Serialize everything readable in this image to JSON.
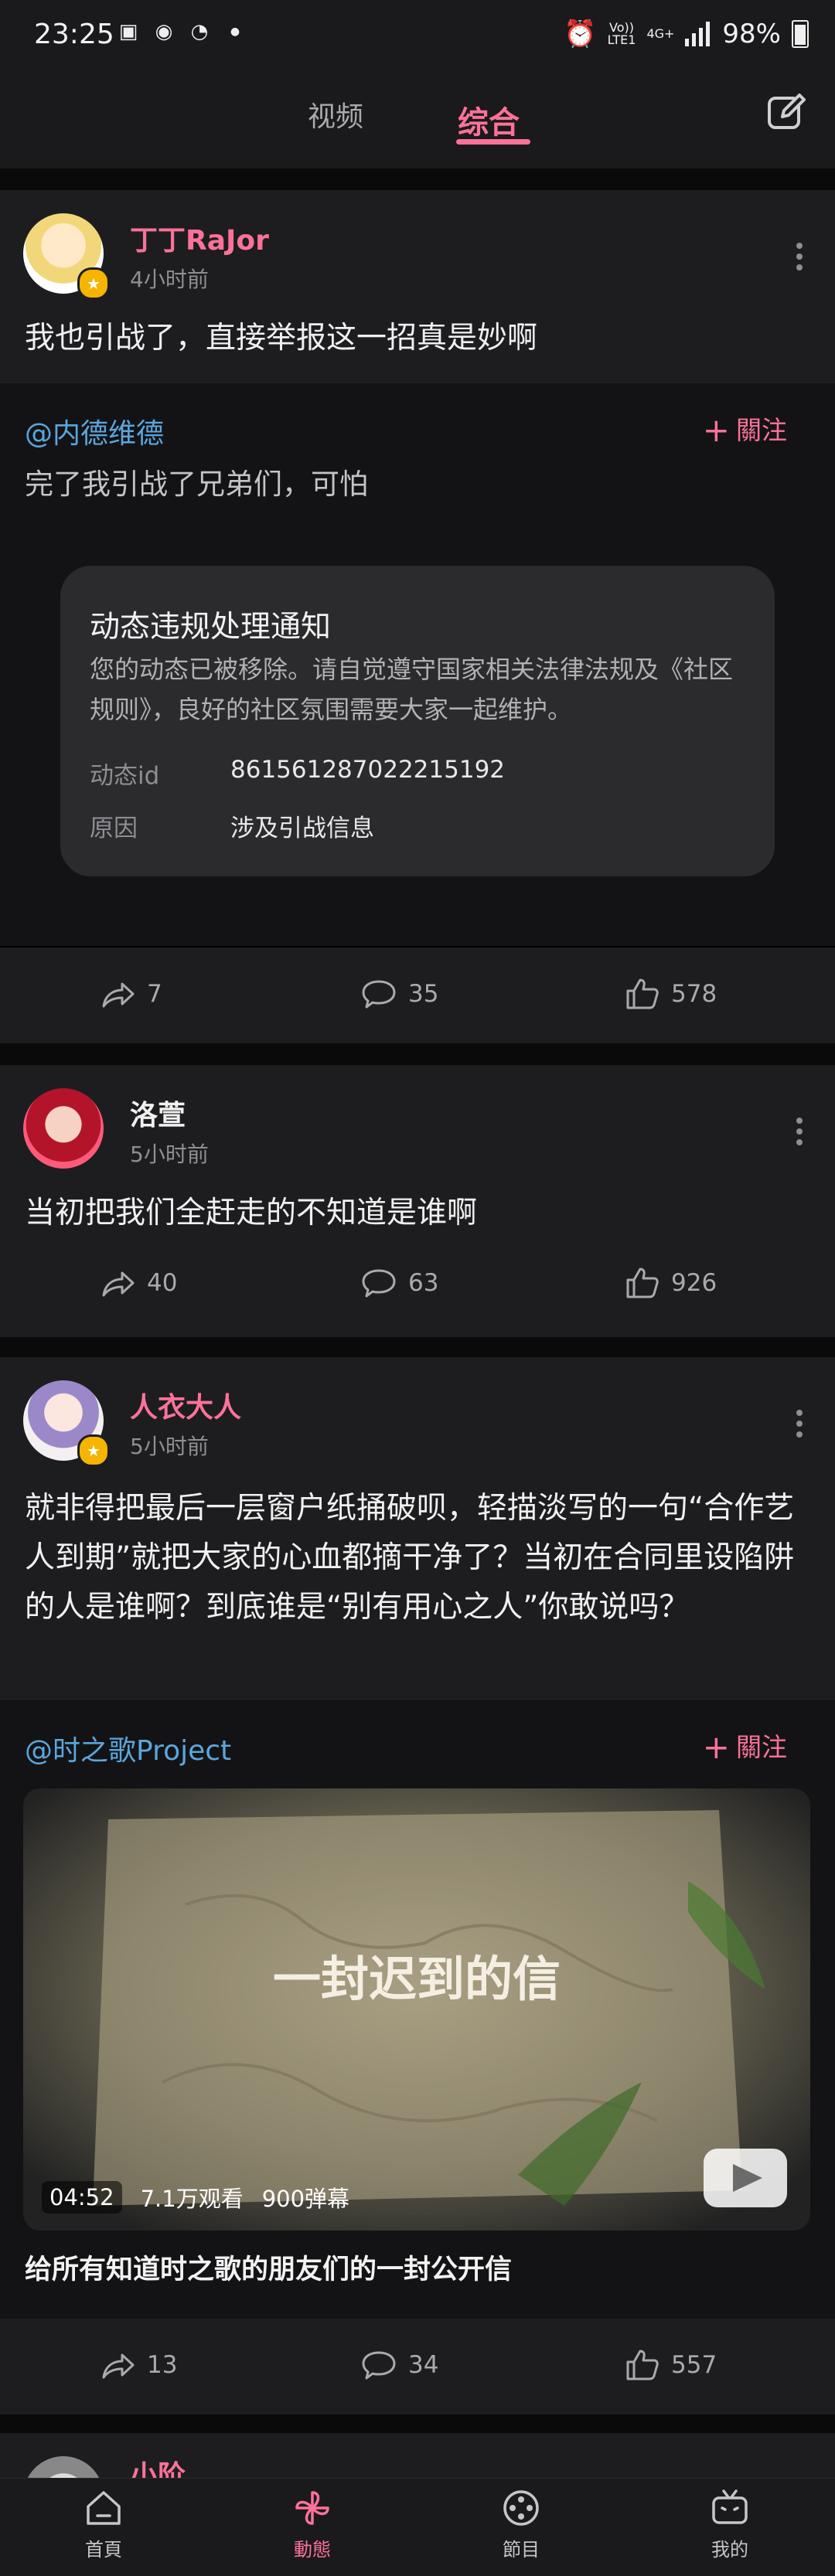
{
  "status_bar": {
    "time": "23:25",
    "network_top": "Vo))",
    "network_bottom": "LTE1",
    "signal_label": "4G+",
    "battery": "98%"
  },
  "header": {
    "tabs": [
      {
        "label": "视频",
        "active": false
      },
      {
        "label": "综合",
        "active": true
      }
    ]
  },
  "posts": [
    {
      "username": "丁丁RaJor",
      "time": "4小时前",
      "text": "我也引战了，直接举报这一招真是妙啊",
      "repost": {
        "author": "@内德维德",
        "follow_label": "關注",
        "text": "完了我引战了兄弟们，可怕",
        "notice": {
          "title": "动态违规处理通知",
          "description": "您的动态已被移除。请自觉遵守国家相关法律法规及《社区规则》，良好的社区氛围需要大家一起维护。",
          "id_label": "动态id",
          "id_value": "861561287022215192",
          "reason_label": "原因",
          "reason_value": "涉及引战信息"
        }
      },
      "shares": "7",
      "comments": "35",
      "likes": "578"
    },
    {
      "username": "洛萱",
      "time": "5小时前",
      "text": "当初把我们全赶走的不知道是谁啊",
      "shares": "40",
      "comments": "63",
      "likes": "926"
    },
    {
      "username": "人衣大人",
      "time": "5小时前",
      "text": "就非得把最后一层窗户纸捅破呗，轻描淡写的一句“合作艺人到期”就把大家的心血都摘干净了？当初在合同里设陷阱的人是谁啊？到底谁是“别有用心之人”你敢说吗？",
      "repost": {
        "author": "@时之歌Project",
        "follow_label": "關注",
        "video": {
          "cover_text": "一封迟到的信",
          "duration": "04:52",
          "views": "7.1万观看",
          "danmaku": "900弹幕",
          "title": "给所有知道时之歌的朋友们的一封公开信"
        }
      },
      "shares": "13",
      "comments": "34",
      "likes": "557"
    },
    {
      "username": "小阶"
    }
  ],
  "bottom_nav": [
    {
      "label": "首頁",
      "icon": "home-icon"
    },
    {
      "label": "動態",
      "icon": "feed-icon",
      "active": true
    },
    {
      "label": "節目",
      "icon": "film-reel-icon"
    },
    {
      "label": "我的",
      "icon": "tv-icon"
    }
  ],
  "colors": {
    "accent": "#fb7299",
    "link": "#5aa6dd",
    "card": "#1d1d20",
    "background": "#000000"
  }
}
